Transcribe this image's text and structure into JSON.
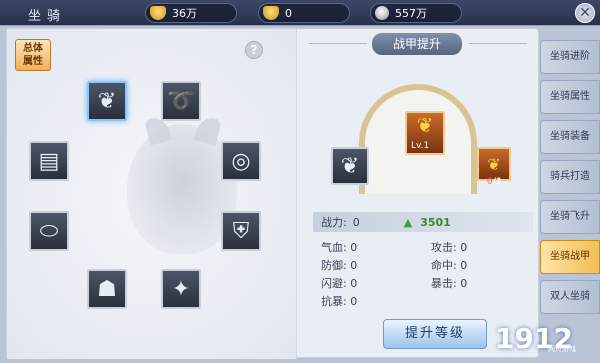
{
  "header": {
    "title": "坐骑",
    "close_icon": "close-icon"
  },
  "currencies": [
    {
      "icon": "gold-ingot-icon",
      "value": "36万"
    },
    {
      "icon": "gold-ingot-icon",
      "value": "0"
    },
    {
      "icon": "silver-coin-icon",
      "value": "557万"
    }
  ],
  "left_panel": {
    "total_attr_label": "总体\n属性",
    "help": "?",
    "slots": [
      "helmet",
      "bridle",
      "chest",
      "collar",
      "saddle",
      "armor-plate",
      "stirrup",
      "bell"
    ]
  },
  "right_panel": {
    "ribbon_title": "战甲提升",
    "level_label": "Lv.1",
    "material_count_have": "0",
    "material_count_need": "/1",
    "power_label": "战力:",
    "power_value": "0",
    "power_next": "3501",
    "stats": [
      {
        "label": "气血:",
        "value": "0"
      },
      {
        "label": "攻击:",
        "value": "0"
      },
      {
        "label": "防御:",
        "value": "0"
      },
      {
        "label": "命中:",
        "value": "0"
      },
      {
        "label": "闪避:",
        "value": "0"
      },
      {
        "label": "暴击:",
        "value": "0"
      },
      {
        "label": "抗暴:",
        "value": "0"
      }
    ],
    "upgrade_button": "提升等级"
  },
  "tabs": [
    "坐骑进阶",
    "坐骑属性",
    "坐骑装备",
    "骑兵打造",
    "坐骑飞升",
    "坐骑战甲",
    "双人坐骑"
  ],
  "active_tab": "坐骑战甲",
  "watermark": {
    "logo": "1912",
    "sub": "网页游戏"
  }
}
